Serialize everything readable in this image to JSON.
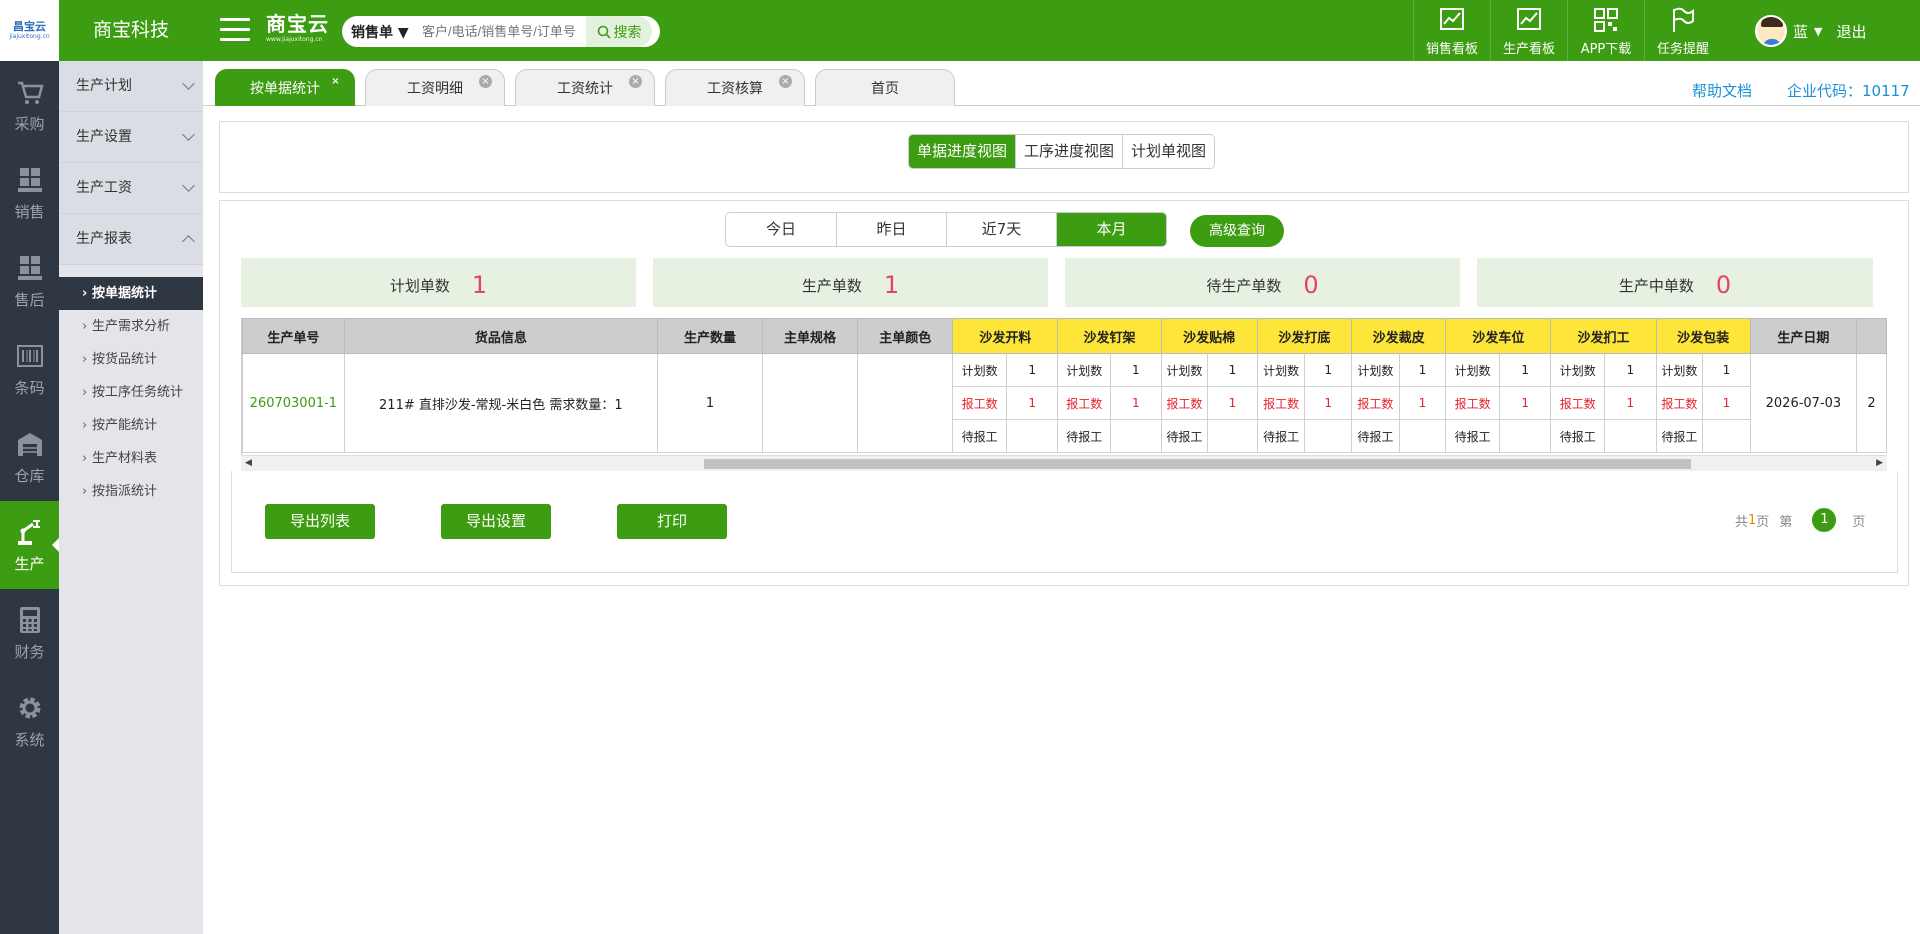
{
  "header": {
    "logo_text": "昌宝云",
    "logo_sub": "jiajuxitong.cn",
    "company": "商宝科技",
    "brand": "商宝云",
    "brand_sub": "www.jiajuxitong.cn",
    "search": {
      "type": "销售单 ▼",
      "placeholder": "客户/电话/销售单号/订单号",
      "button": "搜索"
    },
    "tools": [
      {
        "label": "销售看板",
        "icon": "chart-line-icon"
      },
      {
        "label": "生产看板",
        "icon": "chart-line-icon"
      },
      {
        "label": "APP下载",
        "icon": "qr-code-icon"
      },
      {
        "label": "任务提醒",
        "icon": "flag-icon"
      }
    ],
    "user": {
      "name": "蓝",
      "logout": "退出"
    }
  },
  "sidebar": [
    {
      "label": "采购",
      "icon": "cart-icon"
    },
    {
      "label": "销售",
      "icon": "boxes-icon"
    },
    {
      "label": "售后",
      "icon": "boxes-icon"
    },
    {
      "label": "条码",
      "icon": "barcode-icon"
    },
    {
      "label": "仓库",
      "icon": "warehouse-icon"
    },
    {
      "label": "生产",
      "icon": "robot-arm-icon",
      "active": true
    },
    {
      "label": "财务",
      "icon": "calculator-icon"
    },
    {
      "label": "系统",
      "icon": "gear-icon"
    }
  ],
  "subnav": {
    "groups": [
      "生产计划",
      "生产设置",
      "生产工资",
      "生产报表"
    ],
    "items": [
      "按单据统计",
      "生产需求分析",
      "按货品统计",
      "按工序任务统计",
      "按产能统计",
      "生产材料表",
      "按指派统计"
    ]
  },
  "tabs": [
    {
      "label": "按单据统计",
      "active": true
    },
    {
      "label": "工资明细"
    },
    {
      "label": "工资统计"
    },
    {
      "label": "工资核算"
    },
    {
      "label": "首页"
    }
  ],
  "links": {
    "help": "帮助文档",
    "corp": "企业代码：10117"
  },
  "views": [
    "单据进度视图",
    "工序进度视图",
    "计划单视图"
  ],
  "dates": [
    "今日",
    "昨日",
    "近7天",
    "本月"
  ],
  "advanced_query": "高级查询",
  "stats": [
    {
      "label": "计划单数",
      "value": "1"
    },
    {
      "label": "生产单数",
      "value": "1"
    },
    {
      "label": "待生产单数",
      "value": "0"
    },
    {
      "label": "生产中单数",
      "value": "0"
    }
  ],
  "table": {
    "headers": [
      "生产单号",
      "货品信息",
      "生产数量",
      "主单规格",
      "主单颜色"
    ],
    "process_headers": [
      "沙发开料",
      "沙发钉架",
      "沙发贴棉",
      "沙发打底",
      "沙发裁皮",
      "沙发车位",
      "沙发扪工",
      "沙发包装"
    ],
    "date_header": "生产日期",
    "sub_labels": [
      "计划数",
      "报工数",
      "待报工"
    ],
    "row": {
      "order_no": "260703001-1",
      "goods": "211# 直排沙发-常规-米白色 需求数量：1",
      "qty": "1",
      "spec": "",
      "color": "",
      "plan": "1",
      "reported": "1",
      "pending": "",
      "date": "2026-07-03",
      "next_partial": "2"
    }
  },
  "footer": {
    "buttons": [
      "导出列表",
      "导出设置",
      "打印"
    ],
    "pager": {
      "total_prefix": "共",
      "total": "1",
      "total_suffix": "页",
      "page_prefix": "第",
      "current": "1",
      "page_suffix": "页"
    }
  },
  "colors": {
    "brand_green": "#3c9c12",
    "sidebar_dark": "#2f3742",
    "process_yellow": "#fde53a",
    "stat_red": "#e5445f"
  }
}
